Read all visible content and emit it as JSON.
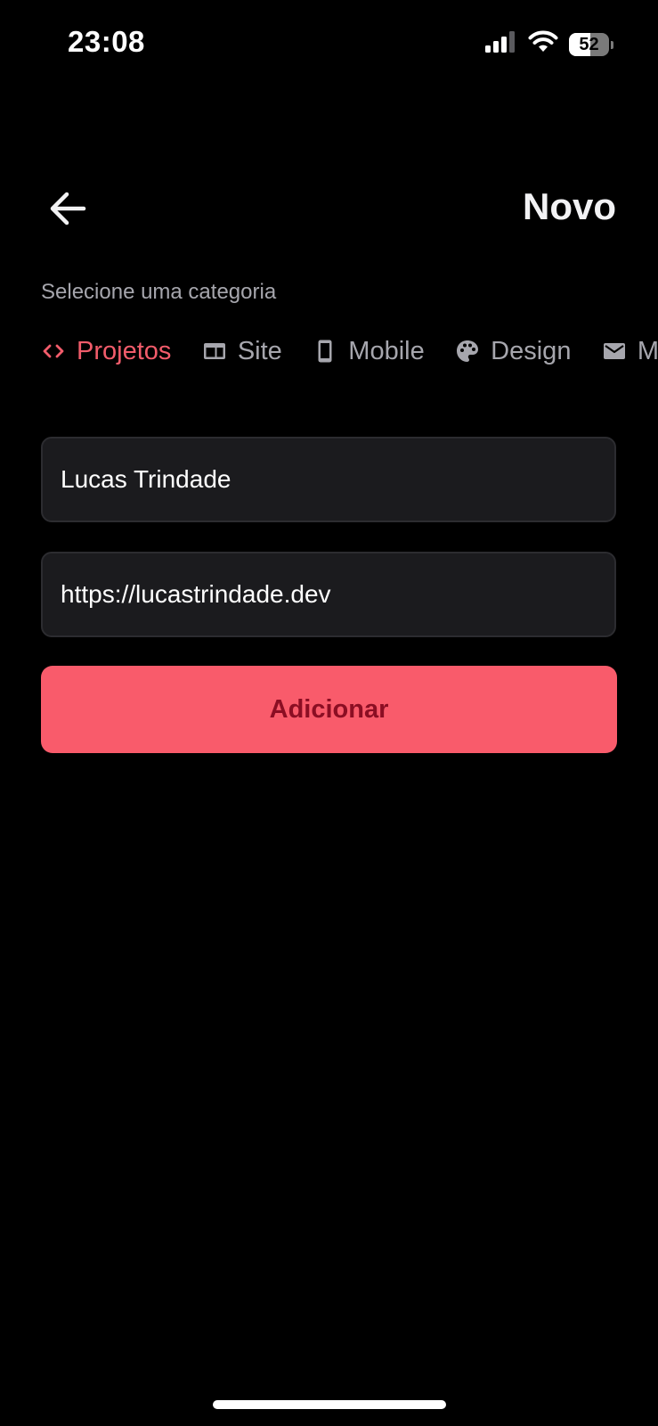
{
  "status_bar": {
    "time": "23:08",
    "battery_level": "52",
    "icons": [
      "cellular-signal-icon",
      "wifi-icon",
      "battery-icon"
    ]
  },
  "header": {
    "back_icon": "arrow-left-icon",
    "title": "Novo"
  },
  "category_section": {
    "label": "Selecione uma categoria",
    "items": [
      {
        "label": "Projetos",
        "icon": "code-icon",
        "selected": true
      },
      {
        "label": "Site",
        "icon": "browser-window-icon",
        "selected": false
      },
      {
        "label": "Mobile",
        "icon": "smartphone-icon",
        "selected": false
      },
      {
        "label": "Design",
        "icon": "palette-icon",
        "selected": false
      },
      {
        "label": "M",
        "icon": "mail-icon",
        "selected": false
      }
    ]
  },
  "form": {
    "name_value": "Lucas Trindade",
    "url_value": "https://lucastrindade.dev",
    "submit_label": "Adicionar"
  },
  "colors": {
    "background": "#000000",
    "accent": "#f95b6b",
    "accent_text": "#8b0e23",
    "field_background": "#1b1b1e",
    "muted_text": "#a6a6ad"
  }
}
